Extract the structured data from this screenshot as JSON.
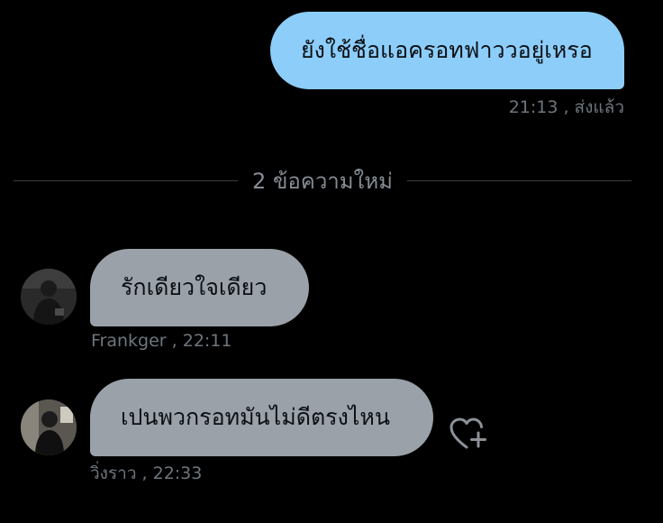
{
  "conversation": {
    "sent_message": {
      "text": "ยังใช้ชื่อแอครอทฟาววอยู่เหรอ",
      "meta": "21:13 , ส่งแล้ว"
    },
    "new_messages_divider": "2 ข้อความใหม่",
    "received_messages": [
      {
        "text": "รักเดียวใจเดียว",
        "meta": "Frankger , 22:11"
      },
      {
        "text": "เปนพวกรอทมันไม่ดีตรงไหน",
        "meta": "วิ่งราว , 22:33"
      }
    ]
  },
  "icons": {
    "add_reaction": "heart-plus-icon"
  },
  "colors": {
    "background": "#000000",
    "sent_bubble": "#8dcdf9",
    "received_bubble": "#9ba1a9",
    "meta_text": "#6e767d"
  }
}
